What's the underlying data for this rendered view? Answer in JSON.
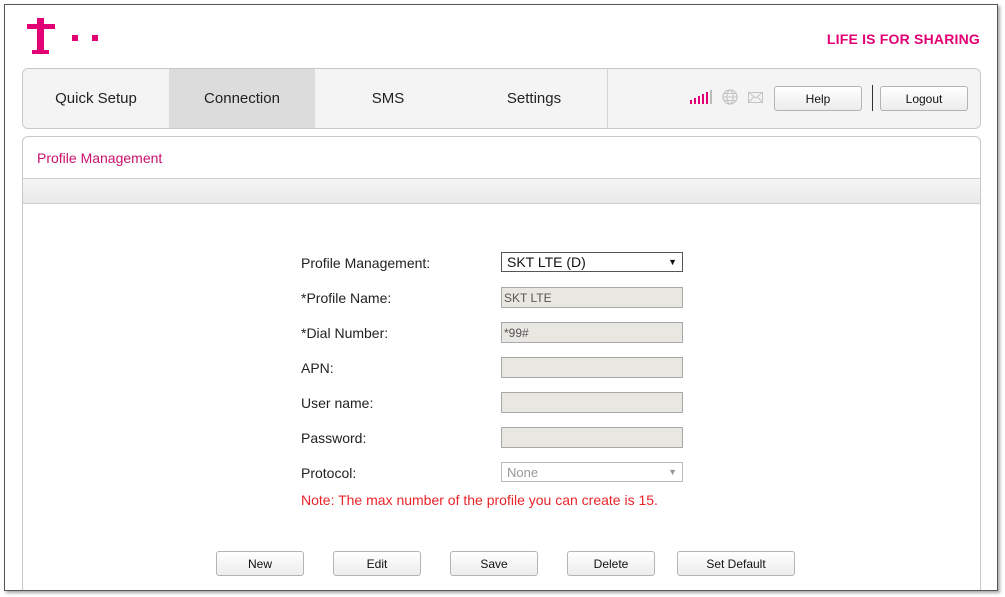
{
  "header": {
    "tagline": "LIFE IS FOR SHARING",
    "brand_color": "#e20074"
  },
  "nav": {
    "tabs": [
      {
        "label": "Quick Setup"
      },
      {
        "label": "Connection",
        "active": true
      },
      {
        "label": "SMS"
      },
      {
        "label": "Settings"
      }
    ],
    "status_icons": [
      "signal-strength-icon",
      "globe-icon",
      "mail-icon"
    ],
    "help_label": "Help",
    "logout_label": "Logout"
  },
  "panel": {
    "title": "Profile Management",
    "title_color": "#c8106e"
  },
  "form": {
    "profile_management": {
      "label": "Profile Management:",
      "value": "SKT LTE (D)"
    },
    "profile_name": {
      "label": "*Profile Name:",
      "value": "SKT LTE"
    },
    "dial_number": {
      "label": "*Dial Number:",
      "value": "*99#"
    },
    "apn": {
      "label": "APN:",
      "value": ""
    },
    "user_name": {
      "label": "User name:",
      "value": ""
    },
    "password": {
      "label": "Password:",
      "value": ""
    },
    "protocol": {
      "label": "Protocol:",
      "value": "None"
    },
    "note": "Note: The max number of the profile you can create is 15.",
    "note_color": "#e8242a"
  },
  "actions": {
    "new_label": "New",
    "edit_label": "Edit",
    "save_label": "Save",
    "delete_label": "Delete",
    "set_default_label": "Set Default"
  }
}
